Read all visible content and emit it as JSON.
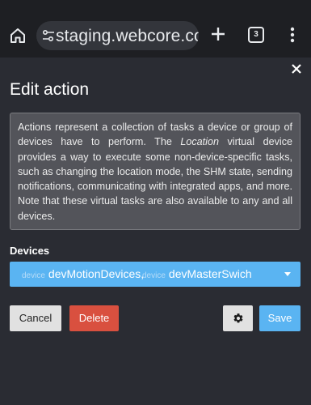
{
  "browser": {
    "url": "staging.webcore.co",
    "tab_count": "3",
    "icons": [
      "home-icon",
      "tune-icon",
      "plus-icon",
      "more-vert-icon"
    ]
  },
  "dialog": {
    "title": "Edit action",
    "description_part1": "Actions represent a collection of tasks a device or group of devices have to perform. The ",
    "description_emphasis": "Location",
    "description_part2": " virtual device provides a way to execute some non-device-specific tasks, such as changing the location mode, the SHM state, sending notifications, communicating with integrated apps, and more. Note that these virtual tasks are also available to any and all devices.",
    "devices_label": "Devices",
    "devices": [
      {
        "kind": "device",
        "name": "devMotionDevices,"
      },
      {
        "kind": "device",
        "name": "devMasterSwich"
      }
    ],
    "buttons": {
      "cancel": "Cancel",
      "delete": "Delete",
      "save": "Save"
    }
  },
  "colors": {
    "background": "#2a2c33",
    "browser_bar": "#1e1f23",
    "description_bg": "#53545a",
    "accent_blue": "#5ab4f2",
    "delete_red": "#d9503f",
    "neutral_button": "#e1e1e1"
  }
}
